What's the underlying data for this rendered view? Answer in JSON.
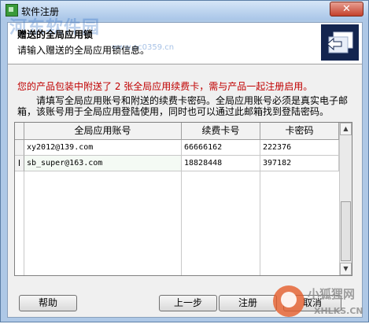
{
  "window": {
    "title": "软件注册",
    "close_label": "✕"
  },
  "header": {
    "title": "赠送的全局应用锁",
    "subtitle": "请输入赠送的全局应用锁信息。",
    "watermark": "河东软件园",
    "watermark_url": "www.pc0359.cn"
  },
  "notice": "您的产品包装中附送了 2 张全局应用续费卡，需与产品一起注册启用。",
  "instruction": "请填写全局应用账号和附送的续费卡密码。全局应用账号必须是真实电子邮箱，该账号用于全局应用登陆使用，同时也可以通过此邮箱找到登陆密码。",
  "grid": {
    "columns": [
      "全局应用账号",
      "续费卡号",
      "卡密码"
    ],
    "rows": [
      {
        "indicator": "",
        "account": "xy2012@139.com",
        "card": "66666162",
        "password": "222376"
      },
      {
        "indicator": "I",
        "account": "sb_super@163.com",
        "card": "18828448",
        "password": "397182"
      }
    ]
  },
  "buttons": {
    "help": "帮助",
    "prev": "上一步",
    "register": "注册",
    "cancel": "取消"
  },
  "corner_watermark": {
    "text": "小狐狸网",
    "url": "XHLKS.CN"
  },
  "colors": {
    "notice": "#c00000",
    "header_icon_bg": "#13254f",
    "title_bar": "#aec8e6"
  }
}
